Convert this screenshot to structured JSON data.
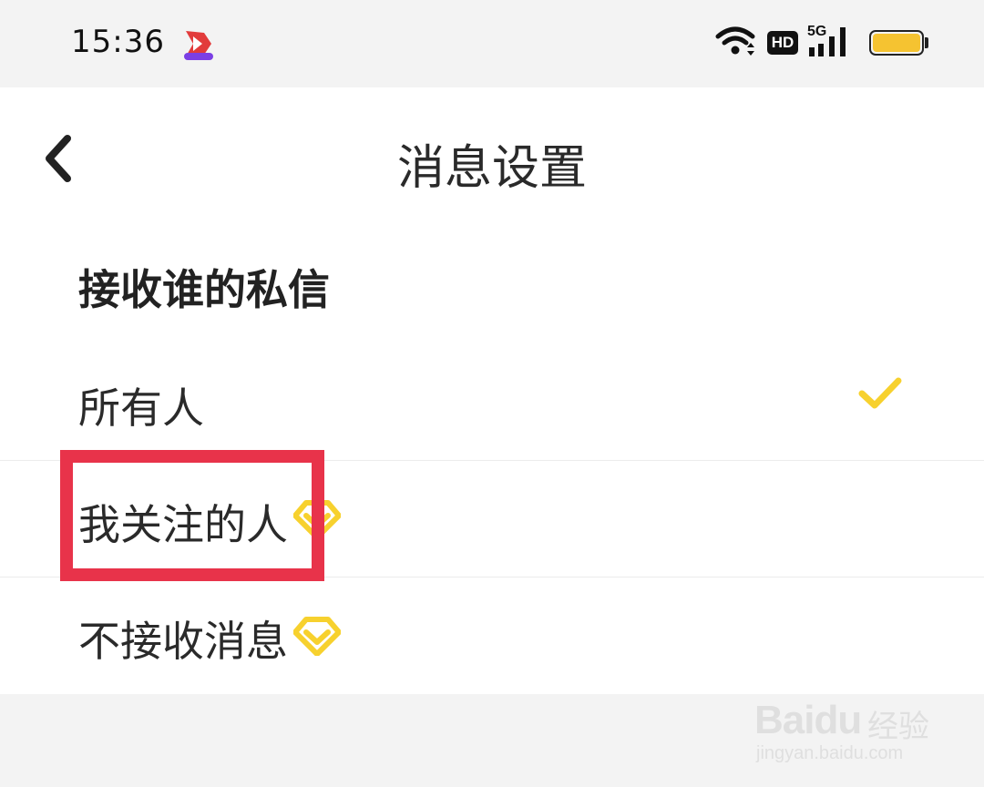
{
  "status_bar": {
    "time": "15:36",
    "app_badge_icon": "app-logo-icon",
    "hd_label": "HD",
    "network_label": "5G",
    "battery_color": "#f5c331"
  },
  "header": {
    "back_icon": "chevron-left-icon",
    "title": "消息设置"
  },
  "section": {
    "title": "接收谁的私信"
  },
  "options": [
    {
      "label": "所有人",
      "selected": true,
      "vip": false
    },
    {
      "label": "我关注的人",
      "selected": false,
      "vip": true
    },
    {
      "label": "不接收消息",
      "selected": false,
      "vip": true
    }
  ],
  "accent_color": "#f7d12e",
  "highlight_color": "#e8334a",
  "watermark": {
    "logo": "Baidu",
    "cn": "经验",
    "url": "jingyan.baidu.com"
  }
}
